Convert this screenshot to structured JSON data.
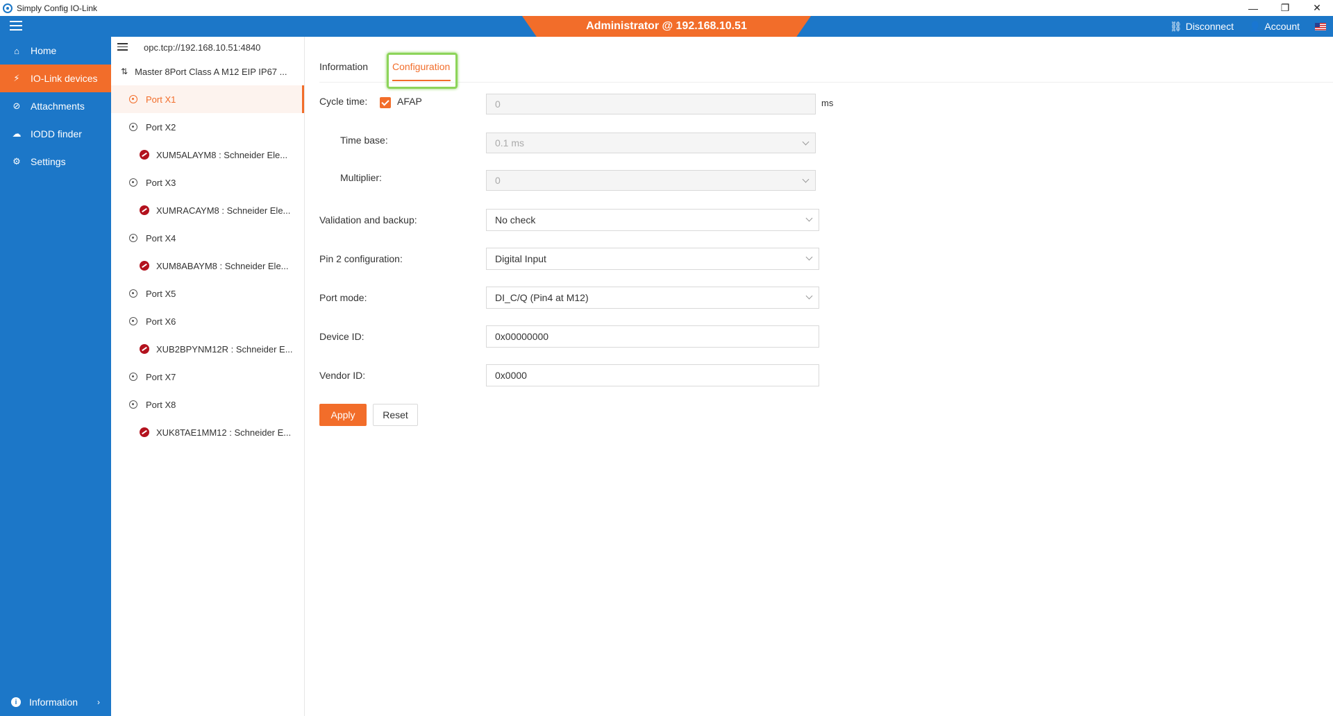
{
  "window": {
    "title": "Simply Config IO-Link",
    "controls": {
      "minimize": "—",
      "maximize": "❐",
      "close": "✕"
    }
  },
  "header": {
    "banner": "Administrator @ 192.168.10.51",
    "disconnect_label": "Disconnect",
    "account_label": "Account"
  },
  "sidebar": {
    "items": [
      {
        "label": "Home",
        "icon": "home-icon"
      },
      {
        "label": "IO-Link devices",
        "icon": "plug-icon"
      },
      {
        "label": "Attachments",
        "icon": "paperclip-icon"
      },
      {
        "label": "IODD finder",
        "icon": "cloud-icon"
      },
      {
        "label": "Settings",
        "icon": "gear-icon"
      }
    ],
    "active_index": 1,
    "bottom_label": "Information"
  },
  "tree": {
    "connection": "opc.tcp://192.168.10.51:4840",
    "master": "Master 8Port Class A M12 EIP IP67 ...",
    "rows": [
      {
        "type": "port",
        "label": "Port X1",
        "selected": true
      },
      {
        "type": "port",
        "label": "Port X2"
      },
      {
        "type": "device",
        "label": "XUM5ALAYM8 : Schneider Ele..."
      },
      {
        "type": "port",
        "label": "Port X3"
      },
      {
        "type": "device",
        "label": "XUMRACAYM8 : Schneider Ele..."
      },
      {
        "type": "port",
        "label": "Port X4"
      },
      {
        "type": "device",
        "label": "XUM8ABAYM8 : Schneider Ele..."
      },
      {
        "type": "port",
        "label": "Port X5"
      },
      {
        "type": "port",
        "label": "Port X6"
      },
      {
        "type": "device",
        "label": "XUB2BPYNM12R : Schneider E..."
      },
      {
        "type": "port",
        "label": "Port X7"
      },
      {
        "type": "port",
        "label": "Port X8"
      },
      {
        "type": "device",
        "label": "XUK8TAE1MM12 : Schneider E..."
      }
    ]
  },
  "tabs": {
    "information": "Information",
    "configuration": "Configuration",
    "active": "Configuration"
  },
  "form": {
    "cycle_time": {
      "label": "Cycle time:",
      "afap_label": "AFAP",
      "afap_checked": true,
      "value": "0",
      "unit": "ms"
    },
    "time_base": {
      "label": "Time base:",
      "value": "0.1 ms"
    },
    "multiplier": {
      "label": "Multiplier:",
      "value": "0"
    },
    "validation": {
      "label": "Validation and backup:",
      "value": "No check"
    },
    "pin2": {
      "label": "Pin 2 configuration:",
      "value": "Digital Input"
    },
    "port_mode": {
      "label": "Port mode:",
      "value": "DI_C/Q (Pin4 at M12)"
    },
    "device_id": {
      "label": "Device ID:",
      "value": "0x00000000"
    },
    "vendor_id": {
      "label": "Vendor ID:",
      "value": "0x0000"
    },
    "apply_label": "Apply",
    "reset_label": "Reset"
  },
  "colors": {
    "primary_blue": "#1c77c8",
    "accent_orange": "#f26d2a",
    "highlight_green": "#8dd45a"
  }
}
